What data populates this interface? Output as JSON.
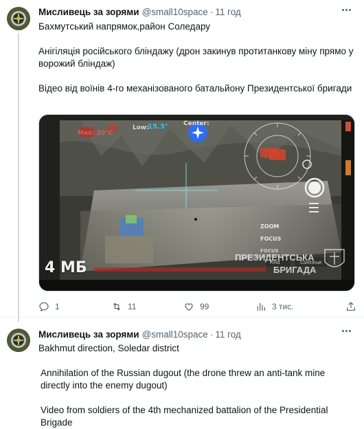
{
  "tweets": [
    {
      "author_name": "Мисливець за зорями",
      "handle": "@small10space",
      "separator": "·",
      "time": "11 год",
      "lines": [
        "Бахмутський напрямок,район Соледару",
        "Анігіляція російського бліндажу (дрон закинув протитанкову міну прямо у ворожий бліндаж)",
        "Відео від воїнів 4-го механізованого батальйону Президентської бригади"
      ],
      "media": {
        "size_label": "4 МБ",
        "watermark_line1": "ПРЕЗИДЕНТСЬКА",
        "watermark_line2": "БРИГАДА",
        "hud": {
          "max": "Max: 20°C",
          "low": "Low:",
          "low_value": "15.3°",
          "center": "Center:",
          "zoom": "ZOOM",
          "focus": "FOCUS",
          "focus2": "FOCUS",
          "find": "Find",
          "continue": "Continue"
        }
      },
      "actions": {
        "replies": "1",
        "retweets": "11",
        "likes": "99",
        "views": "3 тис."
      }
    },
    {
      "author_name": "Мисливець за зорями",
      "handle": "@small10space",
      "separator": "·",
      "time": "11 год",
      "lines": [
        "Bakhmut direction, Soledar district",
        "Annihilation of the Russian dugout (the drone threw an anti-tank mine directly into the enemy dugout)",
        "Video from soldiers of the 4th mechanized battalion of the Presidential Brigade"
      ]
    }
  ],
  "icons": {
    "more": "more-horizontal-icon",
    "reply": "reply-icon",
    "retweet": "retweet-icon",
    "like": "heart-icon",
    "views": "views-icon",
    "share": "share-icon",
    "drone_assistant": "sparkle-icon"
  },
  "colors": {
    "text_primary": "#0f1419",
    "text_secondary": "#536471",
    "thread_line": "#cfd9de",
    "hud_cyan": "#2ec5f2",
    "hud_red": "#e55a4d",
    "assistant_blue": "#2f6cf0"
  }
}
